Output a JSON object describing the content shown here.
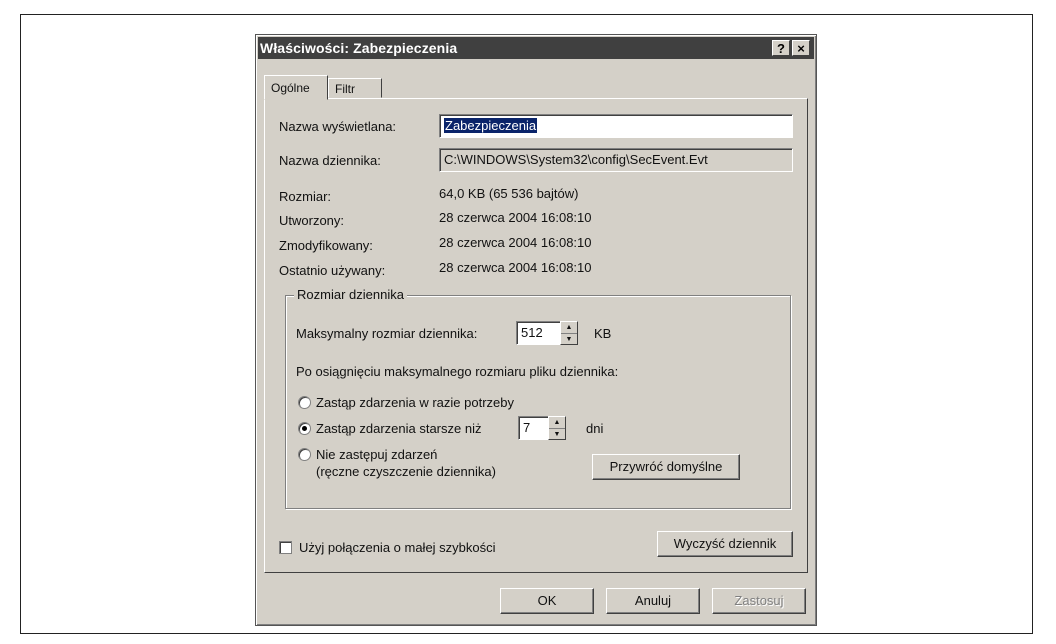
{
  "window": {
    "title": "Właściwości: Zabezpieczenia",
    "help_label": "?",
    "close_label": "×"
  },
  "tabs": [
    {
      "label": "Ogólne",
      "active": true
    },
    {
      "label": "Filtr",
      "active": false
    }
  ],
  "general": {
    "display_name_label": "Nazwa wyświetlana:",
    "display_name_value": "Zabezpieczenia",
    "log_name_label": "Nazwa dziennika:",
    "log_name_value": "C:\\WINDOWS\\System32\\config\\SecEvent.Evt",
    "size_label": "Rozmiar:",
    "size_value": "64,0 KB (65 536 bajtów)",
    "created_label": "Utworzony:",
    "created_value": "28 czerwca 2004 16:08:10",
    "modified_label": "Zmodyfikowany:",
    "modified_value": "28 czerwca 2004 16:08:10",
    "accessed_label": "Ostatnio używany:",
    "accessed_value": "28 czerwca 2004 16:08:10"
  },
  "log_size": {
    "group_title": "Rozmiar dziennika",
    "max_size_label": "Maksymalny rozmiar dziennika:",
    "max_size_value": "512",
    "max_size_unit": "KB",
    "when_full_label": "Po osiągnięciu maksymalnego rozmiaru pliku dziennika:",
    "options": [
      {
        "label": "Zastąp zdarzenia w razie potrzeby",
        "checked": false
      },
      {
        "label": "Zastąp zdarzenia starsze niż",
        "checked": true
      },
      {
        "label": "Nie zastępuj zdarzeń",
        "sublabel": "(ręczne czyszczenie dziennika)",
        "checked": false
      }
    ],
    "days_value": "7",
    "days_unit": "dni",
    "restore_defaults_label": "Przywróć domyślne"
  },
  "low_speed_label": "Użyj połączenia o małej szybkości",
  "low_speed_checked": false,
  "clear_log_label": "Wyczyść dziennik",
  "footer": {
    "ok_label": "OK",
    "cancel_label": "Anuluj",
    "apply_label": "Zastosuj",
    "apply_enabled": false
  }
}
